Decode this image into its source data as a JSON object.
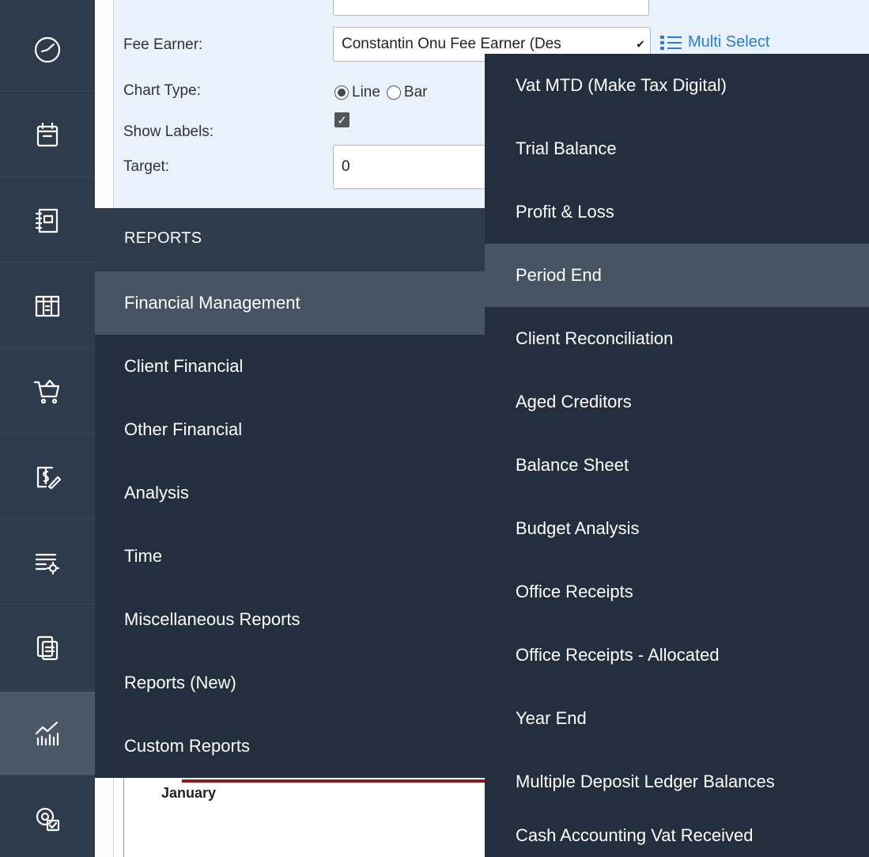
{
  "form": {
    "fee_earner_label": "Fee Earner:",
    "fee_earner_value": "Constantin Onu Fee Earner (Des",
    "multi_select_label": "Multi Select",
    "chart_type_label": "Chart Type:",
    "chart_type_options": [
      "Line",
      "Bar"
    ],
    "chart_type_selected": "Line",
    "show_labels_label": "Show Labels:",
    "show_labels_checked": true,
    "target_label": "Target:",
    "target_value": "0"
  },
  "chart": {
    "x_label": "January"
  },
  "rail": {
    "items": [
      {
        "icon": "dashboard-icon"
      },
      {
        "icon": "calendar-icon"
      },
      {
        "icon": "ledger-icon"
      },
      {
        "icon": "table-icon"
      },
      {
        "icon": "cart-icon"
      },
      {
        "icon": "billing-icon"
      },
      {
        "icon": "list-settings-icon"
      },
      {
        "icon": "documents-icon"
      },
      {
        "icon": "reports-chart-icon"
      },
      {
        "icon": "system-settings-icon"
      }
    ],
    "active_index": 8
  },
  "menu": {
    "header": "REPORTS",
    "items": [
      "Financial Management",
      "Client Financial",
      "Other Financial",
      "Analysis",
      "Time",
      "Miscellaneous Reports",
      "Reports (New)",
      "Custom Reports"
    ],
    "active_index": 0
  },
  "submenu": {
    "items": [
      "Vat MTD (Make Tax Digital)",
      "Trial Balance",
      "Profit & Loss",
      "Period End",
      "Client Reconciliation",
      "Aged Creditors",
      "Balance Sheet",
      "Budget Analysis",
      "Office Receipts",
      "Office  Receipts - Allocated",
      "Year End",
      "Multiple Deposit Ledger Balances",
      "Cash Accounting Vat Received"
    ],
    "active_index": 3
  },
  "colors": {
    "rail_bg": "#2e3b4c",
    "menu_bg": "#232f3e",
    "active_bg": "#465363",
    "link_blue": "#2a7dd4",
    "form_bg": "#e9f1fa"
  }
}
